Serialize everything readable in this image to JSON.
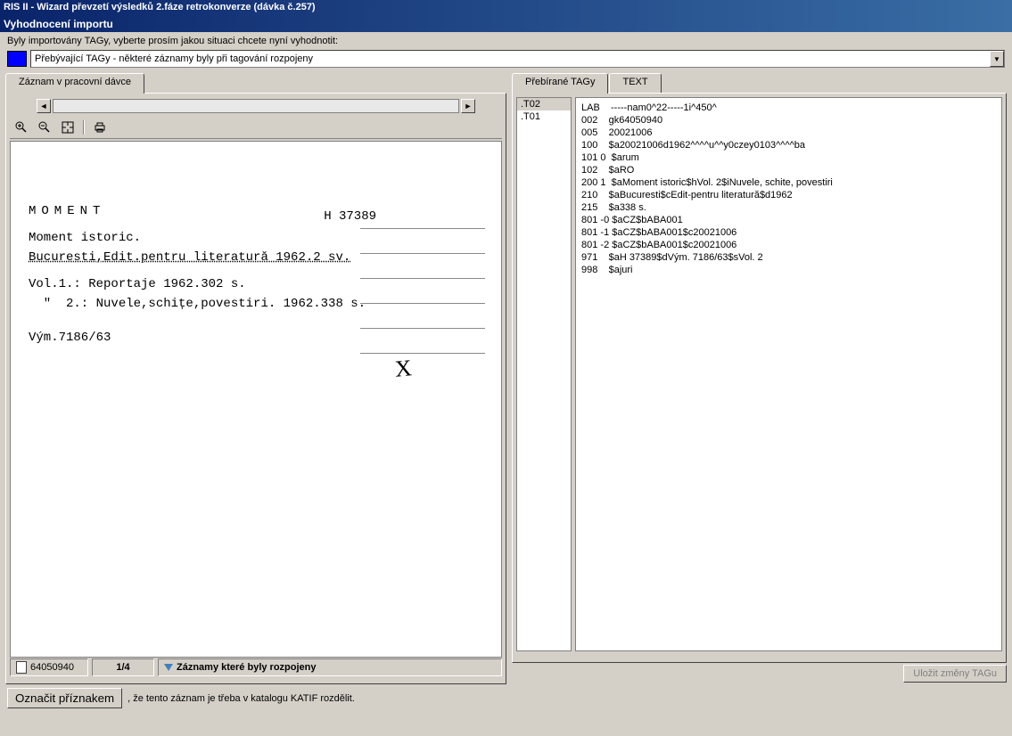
{
  "window": {
    "title": "RIS II  -  Wizard převzetí výsledků 2.fáze retrokonverze (dávka č.257)",
    "subtitle": "Vyhodnocení importu"
  },
  "instruction": "Byly importovány TAGy, vyberte prosím jakou situaci chcete nyní vyhodnotit:",
  "dropdown": {
    "selected": "Přebývající TAGy - některé záznamy byly při tagování rozpojeny"
  },
  "left": {
    "tab": "Záznam v pracovní dávce",
    "card": {
      "title": "MOMENT",
      "code": "H 37389",
      "l1": "Moment istoric.",
      "l2": "Bucuresti,Edit.pentru literatură 1962.2 sv.",
      "l3": "Vol.1.: Reportaje 1962.302 s.",
      "l4": "  \"  2.: Nuvele,schițe,povestiri. 1962.338 s.",
      "l5": "Vým.7186/63"
    },
    "status": {
      "id": "64050940",
      "page": "1/4",
      "filter": "Záznamy které byly rozpojeny"
    }
  },
  "right": {
    "tab1": "Přebírané TAGy",
    "tab2": "TEXT",
    "tags": [
      ".T02",
      ".T01"
    ],
    "record": "LAB    -----nam0^22-----1i^450^\n002    gk64050940\n005    20021006\n100    $a20021006d1962^^^^u^^y0czey0103^^^^ba\n101 0  $arum\n102    $aRO\n200 1  $aMoment istoric$hVol. 2$iNuvele, schite, povestiri\n210    $aBucuresti$cEdit-pentru literatură$d1962\n215    $a338 s.\n801 -0 $aCZ$bABA001\n801 -1 $aCZ$bABA001$c20021006\n801 -2 $aCZ$bABA001$c20021006\n971    $aH 37389$dVým. 7186/63$sVol. 2\n998    $ajuri",
    "save_btn": "Uložit změny TAGu"
  },
  "bottom": {
    "btn": "Označit příznakem",
    "text": ", že tento záznam je třeba v katalogu KATIF rozdělit."
  }
}
